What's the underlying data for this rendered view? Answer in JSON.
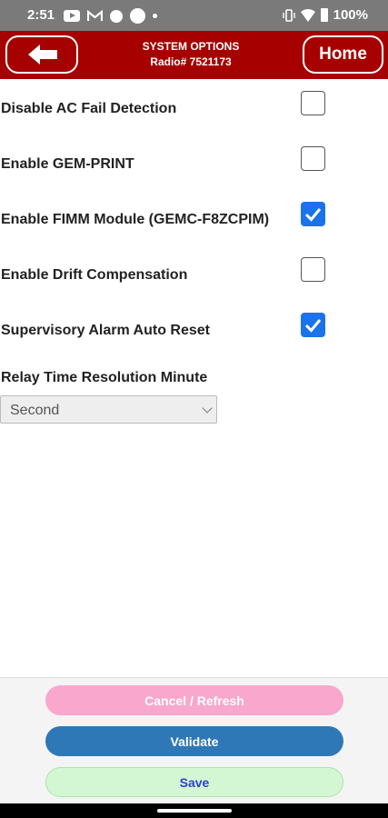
{
  "status_bar": {
    "time": "2:51",
    "battery": "100%",
    "icons": [
      "youtube-icon",
      "gmail-icon",
      "app-icon",
      "circle-icon",
      "dot-icon",
      "vibrate-icon",
      "wifi-icon",
      "battery-icon"
    ]
  },
  "header": {
    "title": "SYSTEM OPTIONS",
    "subtitle": "Radio# 7521173",
    "back_icon": "arrow-left-icon",
    "home_label": "Home",
    "background": "#a60000"
  },
  "options": [
    {
      "label": "Disable AC Fail Detection",
      "checked": false
    },
    {
      "label": "Enable GEM-PRINT",
      "checked": false
    },
    {
      "label": "Enable FIMM Module (GEMC-F8ZCPIM)",
      "checked": true
    },
    {
      "label": "Enable Drift Compensation",
      "checked": false
    },
    {
      "label": "Supervisory Alarm Auto Reset",
      "checked": true
    }
  ],
  "relay": {
    "label": "Relay Time Resolution Minute",
    "selected": "Second"
  },
  "footer": {
    "cancel_label": "Cancel / Refresh",
    "validate_label": "Validate",
    "save_label": "Save"
  },
  "colors": {
    "checkbox_checked": "#1a73e8",
    "cancel_bg": "#f9a7cc",
    "validate_bg": "#2f78b8",
    "save_bg": "#d3f7d3"
  }
}
